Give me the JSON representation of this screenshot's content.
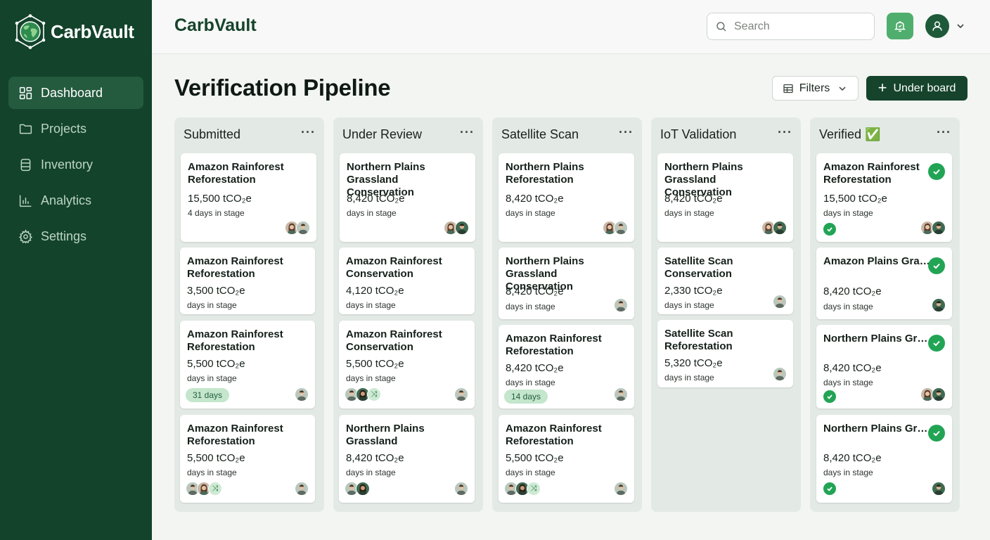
{
  "app": {
    "brand": "CarbVault"
  },
  "sidebar": {
    "items": [
      {
        "label": "Dashboard",
        "icon": "grid-icon",
        "active": true
      },
      {
        "label": "Projects",
        "icon": "folder-icon"
      },
      {
        "label": "Inventory",
        "icon": "database-icon"
      },
      {
        "label": "Analytics",
        "icon": "bar-chart-icon"
      },
      {
        "label": "Settings",
        "icon": "gear-icon"
      }
    ]
  },
  "header": {
    "title": "CarbVault",
    "search_placeholder": "Search",
    "notify_icon": "bell-icon",
    "user_icon": "user-icon"
  },
  "page": {
    "title": "Verification Pipeline",
    "filters_label": "Filters",
    "primary_label": "Under board"
  },
  "colors": {
    "sidebar": "#13432b",
    "accent": "#22a455",
    "column_bg": "#e3eae5",
    "badge_bg": "#c4e6cc"
  },
  "columns": [
    {
      "title": "Submitted",
      "cards": [
        {
          "title": "Amazon Rainforest Reforestation",
          "tonnes": "15,500 tCO₂e",
          "days": "4 days in stage",
          "avatars": [
            "woman",
            "man"
          ]
        },
        {
          "title": "Amazon Rainforest Reforestation",
          "tonnes": "3,500 tCO₂e",
          "days": "days in stage"
        },
        {
          "title": "Amazon Rainforest Reforestation",
          "tonnes": "5,500 tCO₂e",
          "days": "days in stage",
          "badge": "31 days",
          "avatars": [
            "man"
          ]
        },
        {
          "title": "Amazon Rainforest Reforestation",
          "tonnes": "5,500 tCO₂e",
          "days": "days in stage",
          "left_avatars": [
            "man",
            "woman",
            "more"
          ],
          "avatars": [
            "man"
          ]
        }
      ]
    },
    {
      "title": "Under Review",
      "cards": [
        {
          "title": "Northern Plains Grassland Conservation",
          "tonnes": "8,420 tCO₂e",
          "days": "days in stage",
          "avatars": [
            "woman",
            "man"
          ]
        },
        {
          "title": "Amazon Rainforest Conservation",
          "tonnes": "4,120 tCO₂e",
          "days": "days in stage"
        },
        {
          "title": "Amazon Rainforest Conservation",
          "tonnes": "5,500 tCO₂e",
          "days": "days in stage",
          "left_avatars": [
            "man",
            "woman",
            "more"
          ],
          "avatars": [
            "man"
          ]
        },
        {
          "title": "Northern Plains Grassland",
          "tonnes": "8,420 tCO₂e",
          "days": "days in stage",
          "left_avatars": [
            "man",
            "woman"
          ],
          "avatars": [
            "man"
          ]
        }
      ]
    },
    {
      "title": "Satellite Scan",
      "cards": [
        {
          "title": "Northern Plains Reforestation",
          "tonnes": "8,420 tCO₂e",
          "days": "days in stage",
          "avatars": [
            "woman",
            "man"
          ]
        },
        {
          "title": "Northern Plains Grassland Conservation",
          "tonnes": "8,420 tCO₂e",
          "days": "days in stage",
          "avatars": [
            "man"
          ]
        },
        {
          "title": "Amazon Rainforest Reforestation",
          "tonnes": "8,420 tCO₂e",
          "days": "days in stage",
          "badge": "14 days",
          "avatars": [
            "man"
          ]
        },
        {
          "title": "Amazon Rainforest Reforestation",
          "tonnes": "5,500 tCO₂e",
          "days": "days in stage",
          "left_avatars": [
            "man",
            "woman",
            "more"
          ],
          "avatars": [
            "man"
          ]
        }
      ]
    },
    {
      "title": "IoT Validation",
      "cards": [
        {
          "title": "Northern Plains Grassland Conservation",
          "tonnes": "8,420 tCO₂e",
          "days": "days in stage",
          "avatars": [
            "woman",
            "man"
          ]
        },
        {
          "title": "Satellite Scan Conservation",
          "tonnes": "2,330 tCO₂e",
          "days": "days in stage",
          "avatars": [
            "man"
          ]
        },
        {
          "title": "Satellite Scan Reforestation",
          "tonnes": "5,320 tCO₂e",
          "days": "days in stage",
          "avatars": [
            "man"
          ]
        }
      ]
    },
    {
      "title": "Verified ✅",
      "cards": [
        {
          "title": "Amazon Rainforest Reforestation",
          "tonnes": "15,500 tCO₂e",
          "days": "days in stage",
          "verified": true,
          "avatars": [
            "woman",
            "man"
          ]
        },
        {
          "title": "Amazon Plains Grassland Conser...",
          "tonnes": "8,420 tCO₂e",
          "days": "days in stage",
          "avatars": [
            "man"
          ]
        },
        {
          "title": "Northern Plains Grassland Conser...",
          "tonnes": "8,420 tCO₂e",
          "days": "days in stage",
          "verified": true,
          "avatars": [
            "woman",
            "man"
          ]
        },
        {
          "title": "Northern Plains Grassland Conser...",
          "tonnes": "8,420 tCO₂e",
          "days": "days in stage",
          "verified": true,
          "avatars": [
            "man"
          ]
        }
      ]
    }
  ]
}
